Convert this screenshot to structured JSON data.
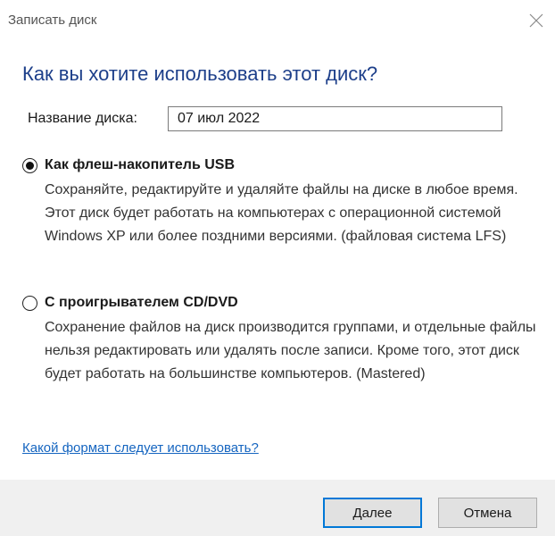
{
  "window": {
    "title": "Записать диск",
    "close_icon": "close-icon"
  },
  "heading": "Как вы хотите использовать этот диск?",
  "disc_name": {
    "label": "Название диска:",
    "value": "07 июл 2022"
  },
  "options": [
    {
      "title": "Как флеш-накопитель USB",
      "description": "Сохраняйте, редактируйте и удаляйте файлы на диске в любое время. Этот диск будет работать на компьютерах с операционной системой Windows XP или более поздними версиями. (файловая система LFS)",
      "selected": true
    },
    {
      "title": "С проигрывателем CD/DVD",
      "description": "Сохранение файлов на диск производится группами, и отдельные файлы нельзя редактировать или удалять после записи. Кроме того, этот диск будет работать на большинстве компьютеров. (Mastered)",
      "selected": false
    }
  ],
  "help_link": "Какой формат следует использовать?",
  "buttons": {
    "next": "Далее",
    "cancel": "Отмена"
  },
  "colors": {
    "heading": "#1d3f8a",
    "link": "#1565c0",
    "default_button_border": "#0078d7",
    "footer_background": "#f0f0f0"
  }
}
